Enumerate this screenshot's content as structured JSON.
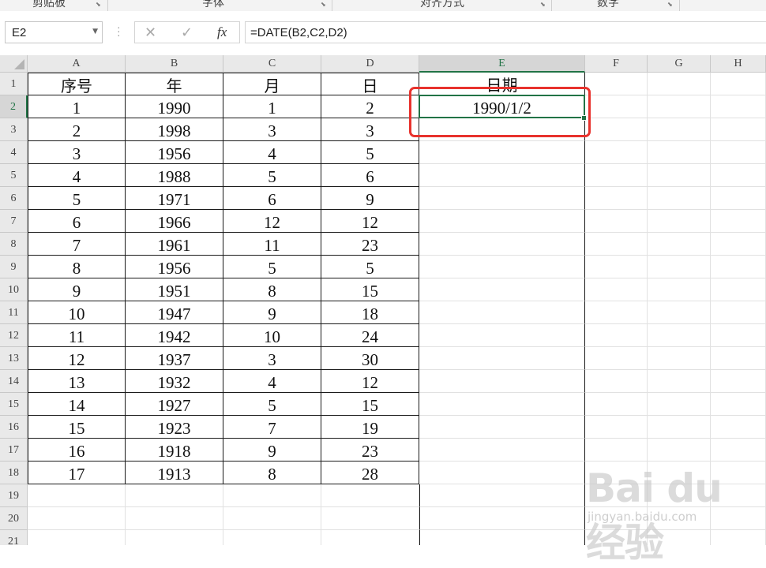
{
  "ribbon": {
    "groups": [
      "剪贴板",
      "字体",
      "对齐方式",
      "数字"
    ]
  },
  "formula_bar": {
    "name_box": "E2",
    "cancel_icon": "✕",
    "enter_icon": "✓",
    "fx_label": "fx",
    "formula": "=DATE(B2,C2,D2)"
  },
  "sheet": {
    "columns": [
      "A",
      "B",
      "C",
      "D",
      "E",
      "F",
      "G",
      "H"
    ],
    "active_column": "E",
    "active_row": 2,
    "header_row": [
      "序号",
      "年",
      "月",
      "日",
      "日期"
    ],
    "rows": [
      [
        "1",
        "1990",
        "1",
        "2",
        "1990/1/2"
      ],
      [
        "2",
        "1998",
        "3",
        "3",
        ""
      ],
      [
        "3",
        "1956",
        "4",
        "5",
        ""
      ],
      [
        "4",
        "1988",
        "5",
        "6",
        ""
      ],
      [
        "5",
        "1971",
        "6",
        "9",
        ""
      ],
      [
        "6",
        "1966",
        "12",
        "12",
        ""
      ],
      [
        "7",
        "1961",
        "11",
        "23",
        ""
      ],
      [
        "8",
        "1956",
        "5",
        "5",
        ""
      ],
      [
        "9",
        "1951",
        "8",
        "15",
        ""
      ],
      [
        "10",
        "1947",
        "9",
        "18",
        ""
      ],
      [
        "11",
        "1942",
        "10",
        "24",
        ""
      ],
      [
        "12",
        "1937",
        "3",
        "30",
        ""
      ],
      [
        "13",
        "1932",
        "4",
        "12",
        ""
      ],
      [
        "14",
        "1927",
        "5",
        "15",
        ""
      ],
      [
        "15",
        "1923",
        "7",
        "19",
        ""
      ],
      [
        "16",
        "1918",
        "9",
        "23",
        ""
      ],
      [
        "17",
        "1913",
        "8",
        "28",
        ""
      ]
    ],
    "row_numbers": [
      "1",
      "2",
      "3",
      "4",
      "5",
      "6",
      "7",
      "8",
      "9",
      "10",
      "11",
      "12",
      "13",
      "14",
      "15",
      "16",
      "17",
      "18",
      "19",
      "20",
      "21"
    ]
  },
  "watermark": {
    "logo": "Bai du 经验",
    "url": "jingyan.baidu.com"
  },
  "colors": {
    "accent_green": "#217346",
    "annotation_red": "#e8322d",
    "table_border": "#1a1a1a"
  }
}
